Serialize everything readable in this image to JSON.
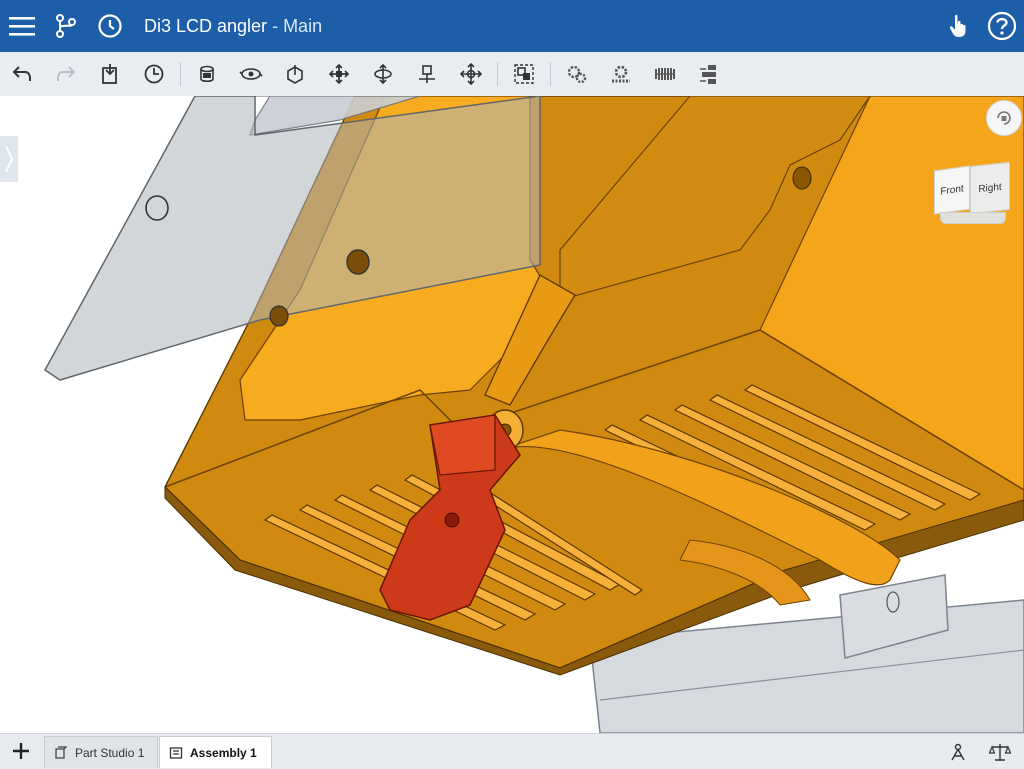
{
  "header": {
    "menu_icon": "hamburger-menu-icon",
    "branch_icon": "version-graph-icon",
    "history_icon": "history-clock-icon",
    "document_name": "Di3 LCD angler",
    "separator": " - ",
    "workspace": "Main",
    "touch_icon": "touch-hand-icon",
    "help_icon": "help-circle-icon",
    "background_color": "#1d5ea8"
  },
  "toolbar": {
    "tools": [
      {
        "name": "undo",
        "icon": "undo-icon"
      },
      {
        "name": "redo",
        "icon": "redo-icon"
      },
      {
        "name": "insert",
        "icon": "insert-part-icon"
      },
      {
        "name": "fix",
        "icon": "fix-icon"
      },
      {
        "name": "fastened-mate",
        "icon": "fastened-mate-icon"
      },
      {
        "name": "revolute-mate",
        "icon": "revolute-mate-icon"
      },
      {
        "name": "slider-mate",
        "icon": "slider-mate-icon"
      },
      {
        "name": "planar-mate",
        "icon": "planar-mate-icon"
      },
      {
        "name": "cylindrical-mate",
        "icon": "cylindrical-mate-icon"
      },
      {
        "name": "pin-slot-mate",
        "icon": "pin-slot-mate-icon"
      },
      {
        "name": "ball-mate",
        "icon": "ball-mate-icon"
      },
      {
        "name": "group",
        "icon": "group-icon"
      },
      {
        "name": "gear-relation",
        "icon": "gear-relation-icon"
      },
      {
        "name": "rack-pinion",
        "icon": "rack-pinion-icon"
      },
      {
        "name": "screw-relation",
        "icon": "screw-relation-icon"
      },
      {
        "name": "linear-relation",
        "icon": "linear-relation-icon"
      }
    ]
  },
  "viewport": {
    "view_cube": {
      "front_label": "Front",
      "right_label": "Right"
    },
    "rotate_icon": "rotate-lock-icon",
    "panel_toggle_icon": "chevron-right-icon",
    "part_colors": {
      "housing": "#f3a21a",
      "clip": "#d73a1c",
      "plates": "#c9ced4"
    }
  },
  "tabs": {
    "add_icon": "plus-icon",
    "items": [
      {
        "label": "Part Studio 1",
        "icon": "part-studio-icon",
        "active": false
      },
      {
        "label": "Assembly 1",
        "icon": "assembly-icon",
        "active": true
      }
    ]
  },
  "bottom_right": {
    "mass_icon": "mass-properties-icon",
    "measure_icon": "measure-balance-icon"
  }
}
